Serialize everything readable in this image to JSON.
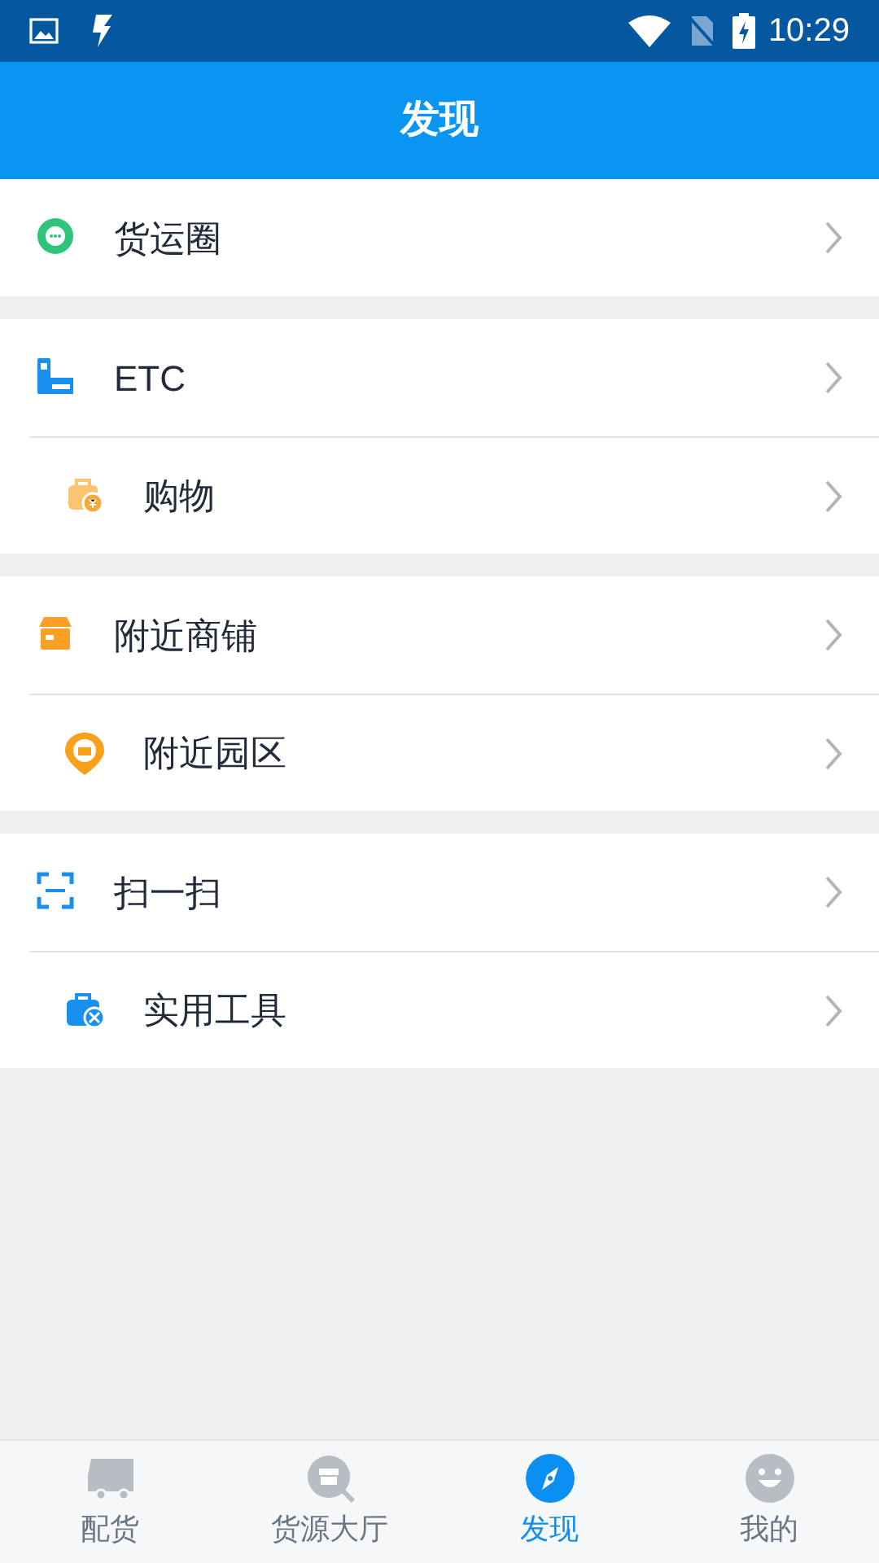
{
  "status_bar": {
    "time": "10:29"
  },
  "header": {
    "title": "发现"
  },
  "groups": [
    {
      "items": [
        {
          "kind": "chat",
          "label": "货运圈"
        }
      ]
    },
    {
      "items": [
        {
          "kind": "etc",
          "label": "ETC"
        },
        {
          "kind": "bag",
          "label": "购物"
        }
      ]
    },
    {
      "items": [
        {
          "kind": "store",
          "label": "附近商铺"
        },
        {
          "kind": "pin",
          "label": "附近园区"
        }
      ]
    },
    {
      "items": [
        {
          "kind": "scan",
          "label": "扫一扫"
        },
        {
          "kind": "toolbox",
          "label": "实用工具"
        }
      ]
    }
  ],
  "tabs": [
    {
      "kind": "truck",
      "label": "配货",
      "selected": false
    },
    {
      "kind": "search",
      "label": "货源大厅",
      "selected": false
    },
    {
      "kind": "compass",
      "label": "发现",
      "selected": true
    },
    {
      "kind": "face",
      "label": "我的",
      "selected": false
    }
  ]
}
